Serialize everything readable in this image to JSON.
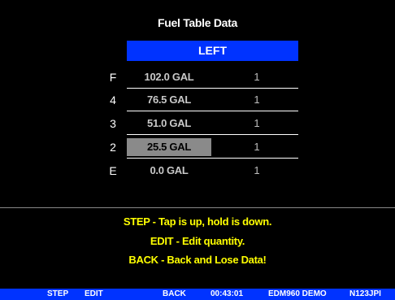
{
  "title": "Fuel Table Data",
  "tank_header": "LEFT",
  "rows": [
    {
      "letter": "F",
      "gallons": "102.0 GAL",
      "tank": "1"
    },
    {
      "letter": "4",
      "gallons": "76.5 GAL",
      "tank": "1"
    },
    {
      "letter": "3",
      "gallons": "51.0 GAL",
      "tank": "1"
    },
    {
      "letter": "2",
      "gallons": "25.5 GAL",
      "tank": "1",
      "selected": true
    },
    {
      "letter": "E",
      "gallons": "0.0 GAL",
      "tank": "1"
    }
  ],
  "help": {
    "line1": "STEP - Tap is up, hold is down.",
    "line2": "EDIT - Edit quantity.",
    "line3": "BACK - Back and Lose Data!"
  },
  "statusbar": {
    "step": "STEP",
    "edit": "EDIT",
    "back": "BACK",
    "time": "00:43:01",
    "device": "EDM960 DEMO",
    "tail": "N123JPI"
  },
  "colors": {
    "header_bg": "#0033ff",
    "help_text": "#ffff00",
    "selected_bg": "#8a8a8a"
  }
}
